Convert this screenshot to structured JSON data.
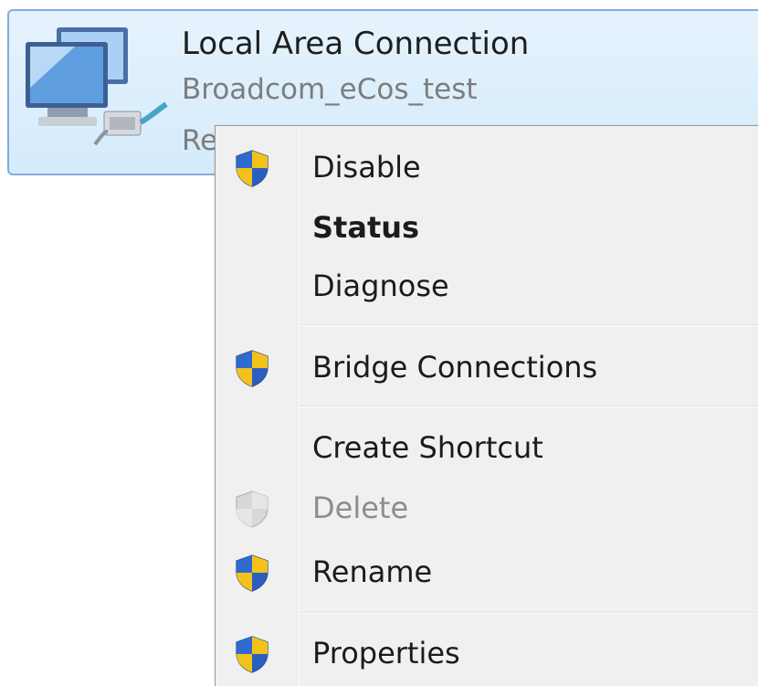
{
  "connection": {
    "name": "Local Area Connection",
    "device": "Broadcom_eCos_test",
    "status_partial": "Re",
    "icon": "network-connection-icon"
  },
  "context_menu": {
    "items": [
      {
        "label": "Disable",
        "icon": "uac-shield-icon",
        "bold": false,
        "enabled": true
      },
      {
        "label": "Status",
        "icon": null,
        "bold": true,
        "enabled": true
      },
      {
        "label": "Diagnose",
        "icon": null,
        "bold": false,
        "enabled": true
      },
      {
        "label": "Bridge Connections",
        "icon": "uac-shield-icon",
        "bold": false,
        "enabled": true
      },
      {
        "label": "Create Shortcut",
        "icon": null,
        "bold": false,
        "enabled": true
      },
      {
        "label": "Delete",
        "icon": "uac-shield-icon",
        "bold": false,
        "enabled": false
      },
      {
        "label": "Rename",
        "icon": "uac-shield-icon",
        "bold": false,
        "enabled": true
      },
      {
        "label": "Properties",
        "icon": "uac-shield-icon",
        "bold": false,
        "enabled": true
      }
    ]
  },
  "colors": {
    "selection_border": "#84acdd",
    "selection_fill": "#d4ebfb",
    "menu_background": "#f0f0f0",
    "shield_blue": "#2a5fbf",
    "shield_yellow": "#f2c21b"
  }
}
